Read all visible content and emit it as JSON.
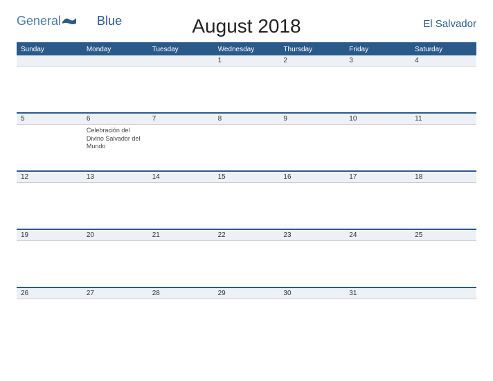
{
  "logo": {
    "text1": "General",
    "text2": "Blue"
  },
  "title": "August 2018",
  "country": "El Salvador",
  "weekdays": [
    "Sunday",
    "Monday",
    "Tuesday",
    "Wednesday",
    "Thursday",
    "Friday",
    "Saturday"
  ],
  "weeks": [
    {
      "numbers": [
        "",
        "",
        "",
        "1",
        "2",
        "3",
        "4"
      ],
      "events": [
        "",
        "",
        "",
        "",
        "",
        "",
        ""
      ]
    },
    {
      "numbers": [
        "5",
        "6",
        "7",
        "8",
        "9",
        "10",
        "11"
      ],
      "events": [
        "",
        "Celebración del Divino Salvador del Mundo",
        "",
        "",
        "",
        "",
        ""
      ]
    },
    {
      "numbers": [
        "12",
        "13",
        "14",
        "15",
        "16",
        "17",
        "18"
      ],
      "events": [
        "",
        "",
        "",
        "",
        "",
        "",
        ""
      ]
    },
    {
      "numbers": [
        "19",
        "20",
        "21",
        "22",
        "23",
        "24",
        "25"
      ],
      "events": [
        "",
        "",
        "",
        "",
        "",
        "",
        ""
      ]
    },
    {
      "numbers": [
        "26",
        "27",
        "28",
        "29",
        "30",
        "31",
        ""
      ],
      "events": [
        "",
        "",
        "",
        "",
        "",
        "",
        ""
      ]
    }
  ]
}
